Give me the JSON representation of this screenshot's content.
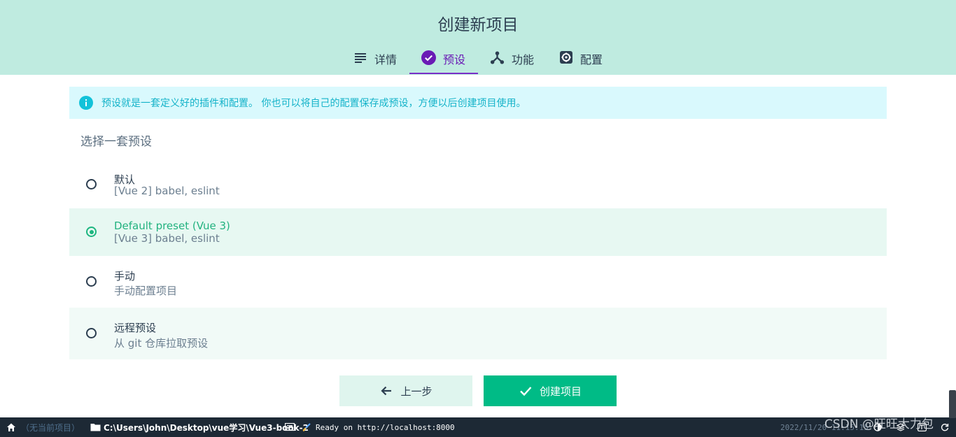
{
  "header": {
    "title": "创建新项目",
    "tabs": [
      {
        "label": "详情",
        "icon": "list-icon"
      },
      {
        "label": "预设",
        "icon": "check-circle-icon"
      },
      {
        "label": "功能",
        "icon": "fork-icon"
      },
      {
        "label": "配置",
        "icon": "gear-icon"
      }
    ],
    "active_tab": "预设"
  },
  "info_banner": {
    "text": "预设就是一套定义好的插件和配置。 你也可以将自己的配置保存成预设，方便以后创建项目使用。",
    "icon": "info-icon"
  },
  "section_title": "选择一套预设",
  "presets": [
    {
      "name": "默认",
      "description": "[Vue 2] babel, eslint",
      "selected": false
    },
    {
      "name": "Default preset (Vue 3)",
      "description": "[Vue 3] babel, eslint",
      "selected": true
    },
    {
      "name": "手动",
      "description": "手动配置项目",
      "selected": false
    },
    {
      "name": "远程预设",
      "description": "从 git 仓库拉取预设",
      "selected": false
    }
  ],
  "buttons": {
    "prev_label": "上一步",
    "create_label": "创建项目"
  },
  "statusbar": {
    "project": "（无当前项目）",
    "path": "C:\\Users\\John\\Desktop\\vue学习\\Vue3-book-2",
    "log": "Ready on http://localhost:8000",
    "datetime": "2022/11/20 11:15:15"
  },
  "watermark": "CSDN @旺旺大力包",
  "colors": {
    "header_bg": "#bfebe0",
    "accent_purple": "#6a1bb5",
    "accent_green": "#00bb86",
    "info_bg": "#d9f9fd",
    "info_text": "#15b3c9",
    "statusbar_bg": "#1d2935"
  }
}
